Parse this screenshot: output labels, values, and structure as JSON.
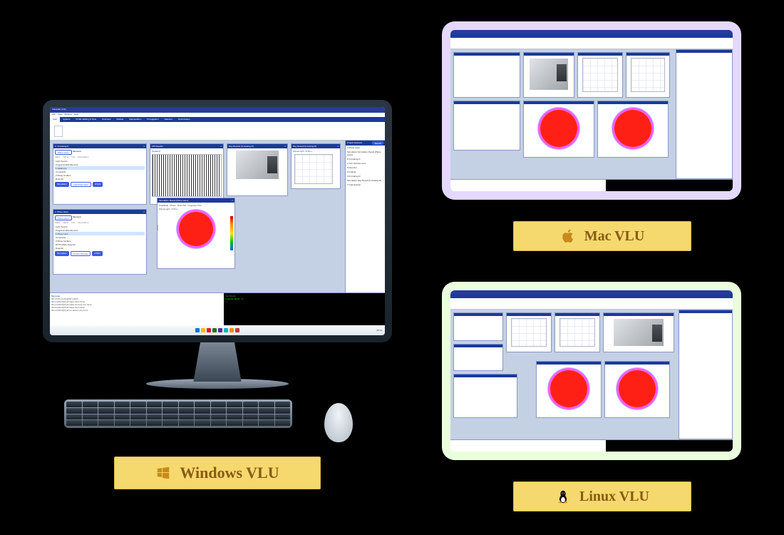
{
  "captions": {
    "windows": "Windows VLU",
    "mac": "Mac VLU",
    "linux": "Linux VLU"
  },
  "app": {
    "title": "Visionlab Unity",
    "menubar": [
      "File",
      "View",
      "Window",
      "Help"
    ],
    "ribbon_tabs": [
      "Start",
      "System",
      "Profile Editing & View",
      "Overview",
      "Module",
      "Manipulation",
      "Propagation",
      "Detector",
      "Optimization"
    ],
    "ribbon_active": "Start",
    "panels": {
      "grating": {
        "title": "6: S-Grating-D",
        "tabs": [
          "Plane wave",
          "Element"
        ],
        "columns": [
          "Index",
          "Name",
          "Info",
          "Description"
        ],
        "rows": [
          "Light Source",
          "Programmable Element",
          "IdealLens",
          "Composite",
          "Plane Surface",
          "Detector"
        ],
        "row_values": [
          "1",
          "2"
        ],
        "buttons": [
          "Simulation",
          "Light Path View",
          "HT&IF"
        ]
      },
      "vpi": {
        "title": "VPI Results",
        "tabs": [
          "Toolwind"
        ],
        "axis_label": "Ray Region"
      },
      "rayresults": {
        "title": "Ray Results [S-Grating-D]"
      },
      "rayresult": {
        "title": "Ray Result [S-Grating-D]",
        "subtitle": "Wavelength: 470nm"
      },
      "planewave": {
        "title": "1: Plane wave",
        "tabs": [
          "Plane wave",
          "Element"
        ],
        "columns": [
          "Index",
          "Name",
          "Info",
          "Description"
        ],
        "rows": [
          "Light Source",
          "Programmable Element",
          "Plane Lens",
          "Composite",
          "Plane Surface",
          "DOTS Wide Detector",
          "Detector"
        ],
        "row_values": [
          "1",
          "2"
        ],
        "buttons": [
          "Simulation",
          "Profile Operate",
          "HT&IF"
        ]
      },
      "simresult": {
        "title": "Simulation Result [Plane wave]",
        "tabs": [
          "Amplitude",
          "Phase",
          "Real Part",
          "Imaginary Part"
        ],
        "subtitle": "Wavelength: 470nm",
        "y_axis": "y/mm"
      }
    },
    "project_explorer": {
      "title": "Project Explorer",
      "search_btn": "Search",
      "items": [
        "1.Plane wave",
        "Simulation.Simulation Result [Plane wave]",
        "6.S-Grating-D",
        "2.Two Surface Lens",
        "5.Detector",
        "3.Grating",
        "4.S-Grating-D",
        "Simulation.Ray Result [S-Grating-D]",
        "7.Optimization"
      ]
    },
    "messages": {
      "title": "Message",
      "lines": [
        "0/0 (0.0%)        [LOG][INF:LIGHT,",
        "09:14 [INFO][0]    all tasks fetch done.",
        "09:14 [INFO][0]    all tasks success are done.",
        "09:14 [INFO][0]    all tasks fetch done.",
        "09:14 [INFO][0]    all simulation are done."
      ]
    },
    "terminal": {
      "title": "Terminal",
      "lines": [
        "Simple Node v1",
        ">"
      ]
    }
  },
  "taskbar_icons": [
    "#0078d4",
    "#ffb900",
    "#e81123",
    "#107c10",
    "#5c2d91",
    "#00b7c3",
    "#ff8c00",
    "#d13438"
  ],
  "taskbar_time": "09:14"
}
